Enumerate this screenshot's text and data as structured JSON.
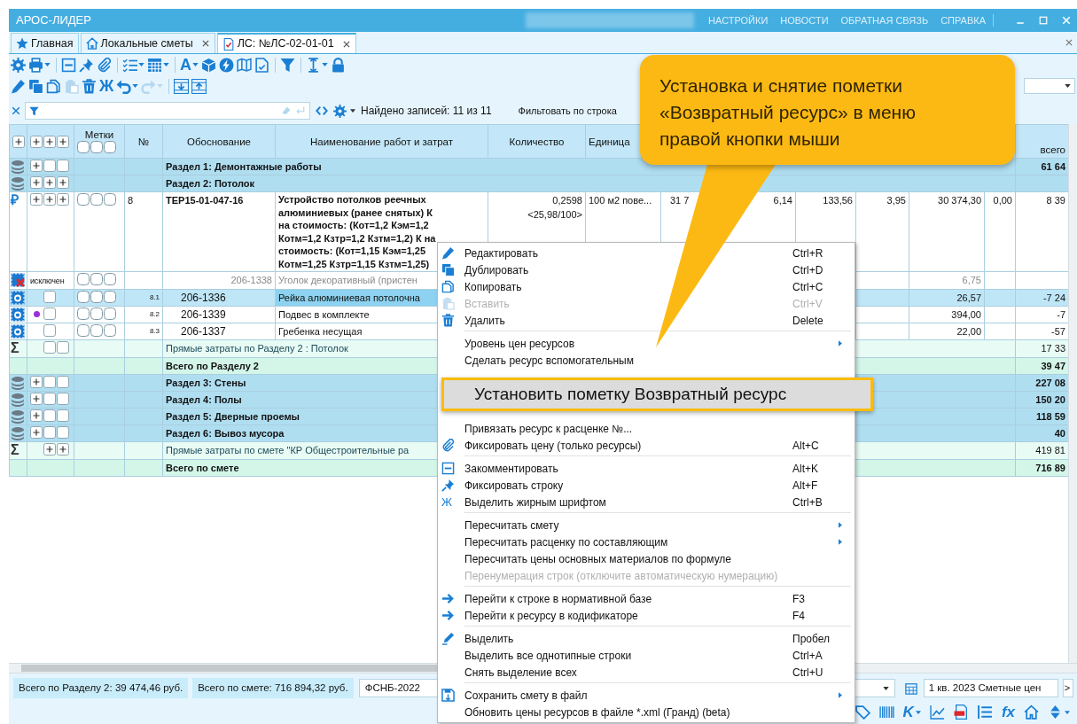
{
  "window": {
    "title": "АРОС-ЛИДЕР",
    "links": [
      "НАСТРОЙКИ",
      "НОВОСТИ",
      "ОБРАТНАЯ СВЯЗЬ",
      "СПРАВКА"
    ]
  },
  "tabs": [
    {
      "label": "Главная",
      "selected": false,
      "closable": false
    },
    {
      "label": "Локальные сметы",
      "selected": false,
      "closable": true
    },
    {
      "label": "ЛС: №ЛС-02-01-01",
      "selected": true,
      "closable": true
    }
  ],
  "toolbar_rows": [
    [
      {
        "dropdown": false,
        "disabled": false,
        "divider_before": false
      },
      {
        "dropdown": true,
        "disabled": false,
        "divider_before": false
      },
      {
        "dropdown": false,
        "disabled": false,
        "divider_before": true
      },
      {
        "dropdown": false,
        "disabled": false,
        "divider_before": false
      },
      {
        "dropdown": false,
        "disabled": false,
        "divider_before": false
      },
      {
        "dropdown": true,
        "disabled": false,
        "divider_before": true
      },
      {
        "dropdown": true,
        "disabled": false,
        "divider_before": false
      },
      {
        "text": "A",
        "dropdown": true,
        "disabled": false,
        "divider_before": true
      },
      {
        "dropdown": false,
        "disabled": false,
        "divider_before": false
      },
      {
        "dropdown": false,
        "disabled": false,
        "divider_before": false
      },
      {
        "dropdown": false,
        "disabled": false,
        "divider_before": false
      },
      {
        "dropdown": false,
        "disabled": false,
        "divider_before": false
      },
      {
        "dropdown": false,
        "disabled": false,
        "divider_before": true
      },
      {
        "dropdown": true,
        "disabled": false,
        "divider_before": true
      },
      {
        "dropdown": false,
        "disabled": false,
        "divider_before": false
      }
    ],
    [
      {
        "dropdown": false,
        "disabled": false,
        "divider_before": false
      },
      {
        "dropdown": false,
        "disabled": false,
        "divider_before": false
      },
      {
        "dropdown": false,
        "disabled": false,
        "divider_before": false
      },
      {
        "dropdown": false,
        "disabled": true,
        "divider_before": false
      },
      {
        "dropdown": false,
        "disabled": false,
        "divider_before": false
      },
      {
        "text": "Ж",
        "dropdown": false,
        "disabled": false,
        "divider_before": false
      },
      {
        "dropdown": true,
        "disabled": false,
        "divider_before": false
      },
      {
        "dropdown": true,
        "disabled": true,
        "divider_before": false
      },
      {
        "dropdown": false,
        "disabled": false,
        "divider_before": true
      },
      {
        "dropdown": false,
        "disabled": false,
        "divider_before": false
      }
    ]
  ],
  "filter_bar": {
    "found": "Найдено записей: 11 из 11",
    "filter_label": "Фильтовать по строка"
  },
  "table": {
    "header": {
      "marks": "Метки",
      "number": "№",
      "basis": "Обоснование",
      "name": "Наименование работ и затрат",
      "quantity": "Количество",
      "unit": "Единица",
      "total": "всего"
    },
    "rows": [
      {
        "kind": "section",
        "selected": false,
        "toggles": [
          {
            "kind": "plus"
          },
          {
            "kind": "box"
          },
          {
            "kind": "box"
          }
        ],
        "title": "Раздел 1: Демонтажные работы",
        "total": "61 64"
      },
      {
        "kind": "section",
        "selected": false,
        "toggles": [
          {
            "kind": "plus"
          },
          {
            "kind": "plus"
          },
          {
            "kind": "plus"
          }
        ],
        "title": "Раздел 2: Потолок"
      },
      {
        "kind": "item",
        "selected": false,
        "icon_text": "₽",
        "toggles": [
          {
            "kind": "plus"
          },
          {
            "kind": "plus"
          },
          {
            "kind": "plus"
          }
        ],
        "labels": [
          false,
          false,
          false
        ],
        "number": "8",
        "code": "ТЕР15-01-047-16",
        "name": "Устройство потолков реечных алюминиевых (ранее снятых) К на стоимость: (Кот=1,2 Кэм=1,2 Котм=1,2 Кзтр=1,2 Кзтм=1,2) К на стоимость: (Кот=1,15 Кэм=1,25 Котм=1,25 Кзтр=1,15 Кзтм=1,25)",
        "quantity": "0,2598",
        "quantity_note": "<25,98/100>",
        "unit": "100 м2 пове...",
        "values": {
          "column_9": "31 7",
          "column_10": "6,14",
          "column_11": "133,56",
          "column_12": "3,95",
          "column_13": "30 374,30",
          "column_14": "0,00"
        },
        "total": "8 39"
      },
      {
        "kind": "excluded",
        "selected": false,
        "status_text": "исключен",
        "labels": [
          false,
          false,
          false
        ],
        "code": "206-1338",
        "name": "Уголок декоративный (пристен",
        "values": {
          "column_13": "6,75"
        }
      },
      {
        "kind": "resource",
        "selected": true,
        "toggles": [
          {
            "kind": "empty"
          },
          {
            "kind": "box"
          },
          {
            "kind": "empty"
          }
        ],
        "labels": [
          false,
          false,
          false
        ],
        "number": "8.1",
        "code": "206-1336",
        "name": "Рейка алюминиевая потолочна",
        "values": {
          "column_13": "26,57"
        },
        "total": "-7 24"
      },
      {
        "kind": "resource",
        "selected": false,
        "toggles": [
          {
            "kind": "dot",
            "color": "#9b2fd6"
          },
          {
            "kind": "box"
          },
          {
            "kind": "empty"
          }
        ],
        "labels": [
          false,
          false,
          false
        ],
        "number": "8.2",
        "code": "206-1339",
        "name": "Подвес в комплекте",
        "values": {
          "column_13": "394,00"
        },
        "total": "-7"
      },
      {
        "kind": "resource",
        "selected": false,
        "toggles": [
          {
            "kind": "empty"
          },
          {
            "kind": "box"
          },
          {
            "kind": "empty"
          }
        ],
        "labels": [
          false,
          false,
          false
        ],
        "number": "8.3",
        "code": "206-1337",
        "name": "Гребенка несущая",
        "values": {
          "column_13": "22,00"
        },
        "total": "-57"
      },
      {
        "kind": "subtotal",
        "selected": false,
        "icon_text": "Σ",
        "toggles": [
          {
            "kind": "empty"
          },
          {
            "kind": "box"
          },
          {
            "kind": "box"
          }
        ],
        "title": "Прямые затраты по Разделу 2 : Потолок",
        "total": "17 33"
      },
      {
        "kind": "total",
        "selected": false,
        "title": "Всего по Разделу 2",
        "total": "39 47"
      },
      {
        "kind": "section",
        "selected": false,
        "toggles": [
          {
            "kind": "plus"
          },
          {
            "kind": "box"
          },
          {
            "kind": "box"
          }
        ],
        "title": "Раздел 3: Стены",
        "total": "227 08"
      },
      {
        "kind": "section",
        "selected": false,
        "toggles": [
          {
            "kind": "plus"
          },
          {
            "kind": "box"
          },
          {
            "kind": "box"
          }
        ],
        "title": "Раздел 4: Полы",
        "total": "150 20"
      },
      {
        "kind": "section",
        "selected": false,
        "toggles": [
          {
            "kind": "plus"
          },
          {
            "kind": "box"
          },
          {
            "kind": "box"
          }
        ],
        "title": "Раздел 5: Дверные проемы",
        "total": "118 59"
      },
      {
        "kind": "section",
        "selected": false,
        "toggles": [
          {
            "kind": "plus"
          },
          {
            "kind": "box"
          },
          {
            "kind": "box"
          }
        ],
        "title": "Раздел 6: Вывоз мусора",
        "total": "40"
      },
      {
        "kind": "subtotal",
        "selected": false,
        "icon_text": "Σ",
        "toggles": [
          {
            "kind": "empty"
          },
          {
            "kind": "plus"
          },
          {
            "kind": "plus"
          }
        ],
        "title": "Прямые затраты по смете \"КР Общестроительные ра",
        "total": "419 81"
      },
      {
        "kind": "total",
        "selected": false,
        "title": "Всего по смете",
        "total": "716 89"
      }
    ]
  },
  "context_menu": {
    "items": [
      {
        "label": "Редактировать",
        "shortcut": "Ctrl+R",
        "disabled": false,
        "submenu": false,
        "highlighted": false,
        "separator_before": false
      },
      {
        "label": "Дублировать",
        "shortcut": "Ctrl+D",
        "disabled": false,
        "submenu": false,
        "highlighted": false,
        "separator_before": false
      },
      {
        "label": "Копировать",
        "shortcut": "Ctrl+C",
        "disabled": false,
        "submenu": false,
        "highlighted": false,
        "separator_before": false
      },
      {
        "label": "Вставить",
        "shortcut": "Ctrl+V",
        "disabled": true,
        "submenu": false,
        "highlighted": false,
        "separator_before": false
      },
      {
        "label": "Удалить",
        "shortcut": "Delete",
        "disabled": false,
        "submenu": false,
        "highlighted": false,
        "separator_before": false
      },
      {
        "label": "Уровень цен ресурсов",
        "disabled": false,
        "submenu": true,
        "highlighted": false,
        "separator_before": true
      },
      {
        "label": "Сделать ресурс вспомогательным",
        "disabled": false,
        "submenu": false,
        "highlighted": false,
        "separator_before": false
      },
      {
        "label": "Установить пометку Возвратный ресурс",
        "disabled": false,
        "submenu": false,
        "highlighted": true,
        "separator_before": false
      },
      {
        "label": "Привязать ресурс к расценке №...",
        "disabled": false,
        "submenu": false,
        "highlighted": false,
        "separator_before": false
      },
      {
        "label": "Фиксировать цену (только ресурсы)",
        "shortcut": "Alt+C",
        "disabled": false,
        "submenu": false,
        "highlighted": false,
        "separator_before": false
      },
      {
        "label": "Закомментировать",
        "shortcut": "Alt+K",
        "disabled": false,
        "submenu": false,
        "highlighted": false,
        "separator_before": true
      },
      {
        "label": "Фиксировать строку",
        "shortcut": "Alt+F",
        "disabled": false,
        "submenu": false,
        "highlighted": false,
        "separator_before": false
      },
      {
        "label": "Выделить жирным шрифтом",
        "shortcut": "Ctrl+B",
        "icon_text": "Ж",
        "disabled": false,
        "submenu": false,
        "highlighted": false,
        "separator_before": false
      },
      {
        "label": "Пересчитать смету",
        "disabled": false,
        "submenu": true,
        "highlighted": false,
        "separator_before": true
      },
      {
        "label": "Пересчитать расценку по составляющим",
        "disabled": false,
        "submenu": true,
        "highlighted": false,
        "separator_before": false
      },
      {
        "label": "Пересчитать цены основных материалов по формуле",
        "disabled": false,
        "submenu": false,
        "highlighted": false,
        "separator_before": false
      },
      {
        "label": "Перенумерация строк (отключите автоматическую нумерацию)",
        "disabled": true,
        "submenu": false,
        "highlighted": false,
        "separator_before": false
      },
      {
        "label": "Перейти к строке в нормативной базе",
        "shortcut": "F3",
        "disabled": false,
        "submenu": false,
        "highlighted": false,
        "separator_before": true
      },
      {
        "label": "Перейти к ресурсу в кодификаторе",
        "shortcut": "F4",
        "disabled": false,
        "submenu": false,
        "highlighted": false,
        "separator_before": false
      },
      {
        "label": "Выделить",
        "shortcut": "Пробел",
        "disabled": false,
        "submenu": false,
        "highlighted": false,
        "separator_before": true
      },
      {
        "label": "Выделить все однотипные строки",
        "shortcut": "Ctrl+A",
        "disabled": false,
        "submenu": false,
        "highlighted": false,
        "separator_before": false
      },
      {
        "label": "Снять выделение всех",
        "shortcut": "Ctrl+U",
        "disabled": false,
        "submenu": false,
        "highlighted": false,
        "separator_before": false
      },
      {
        "label": "Сохранить смету в файл",
        "disabled": false,
        "submenu": true,
        "highlighted": false,
        "separator_before": true
      },
      {
        "label": "Обновить цены ресурсов в файле *.xml (Гранд) (beta)",
        "disabled": false,
        "submenu": false,
        "highlighted": false,
        "separator_before": false
      }
    ]
  },
  "callout": {
    "text": "Установка и снятие пометки «Возвратный ресурс» в меню правой кнопки мыши"
  },
  "status_bar": {
    "totals": [
      "Всего по Разделу 2: 39 474,46 руб.",
      "Всего по смете: 716 894,32 руб."
    ],
    "base": "ФСНБ-2022",
    "period": "1 кв. 2023 Сметные цен",
    "next": ">"
  },
  "bottom_toolbar": [
    {
      "dropdown": false
    },
    {
      "dropdown": false
    },
    {
      "text": "K",
      "dropdown": true
    },
    {
      "dropdown": false
    },
    {
      "dropdown": false
    },
    {
      "dropdown": false
    },
    {
      "text": "fx",
      "dropdown": false
    },
    {
      "dropdown": false
    },
    {
      "dropdown": true
    }
  ]
}
